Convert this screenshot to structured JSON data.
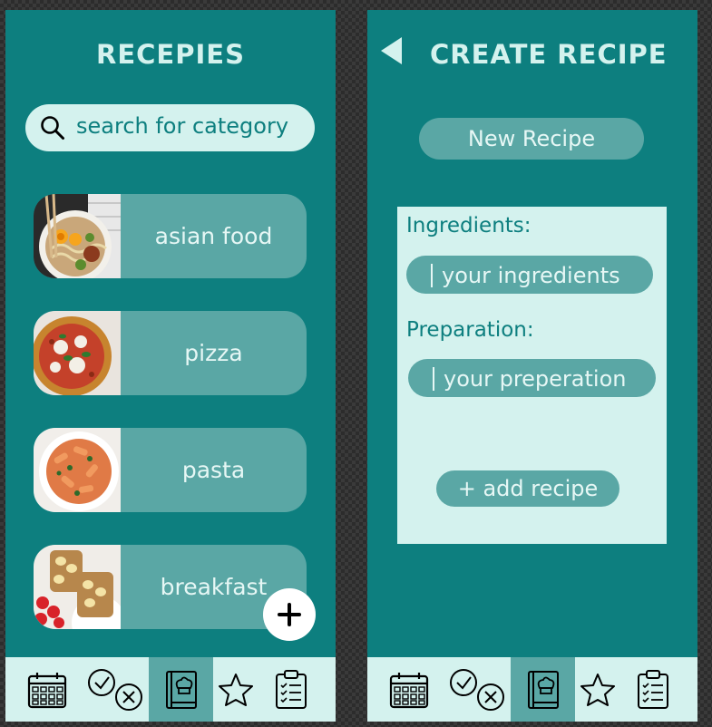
{
  "recipes_screen": {
    "title": "RECEPIES",
    "search": {
      "placeholder": "search for category"
    },
    "categories": [
      {
        "label": "asian food",
        "image": "ramen-bowl"
      },
      {
        "label": "pizza",
        "image": "margherita-pizza"
      },
      {
        "label": "pasta",
        "image": "penne-pasta"
      },
      {
        "label": "breakfast",
        "image": "banana-toast-with-strawberries"
      }
    ],
    "add_button_icon": "plus-icon"
  },
  "create_screen": {
    "title": "CREATE RECIPE",
    "back_icon": "back-arrow-icon",
    "name_field": {
      "value": "New Recipe"
    },
    "ingredients": {
      "label": "Ingredients:",
      "placeholder": "your ingredients"
    },
    "preparation": {
      "label": "Preparation:",
      "placeholder": "your preperation"
    },
    "add_button": {
      "label": "+ add recipe"
    }
  },
  "bottom_nav": {
    "items": [
      {
        "icon": "calendar-icon",
        "active": false
      },
      {
        "icon": "check-cross-icon",
        "active": false
      },
      {
        "icon": "recipe-book-icon",
        "active": true
      },
      {
        "icon": "star-icon",
        "active": false
      },
      {
        "icon": "clipboard-list-icon",
        "active": false
      }
    ]
  },
  "colors": {
    "primary": "#0d7f7f",
    "accent": "#5aa7a5",
    "light": "#d4f2ee",
    "text_light": "#e6f7f5"
  }
}
